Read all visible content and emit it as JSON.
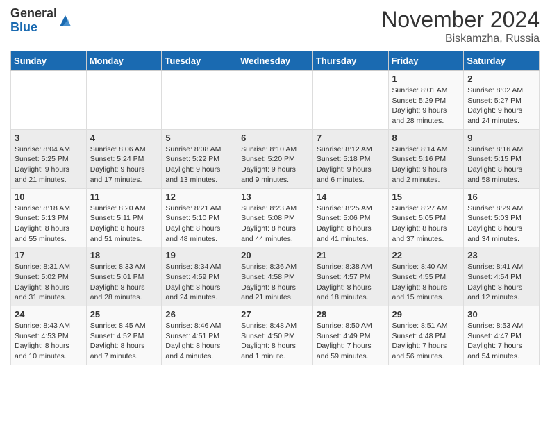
{
  "header": {
    "logo_general": "General",
    "logo_blue": "Blue",
    "month_title": "November 2024",
    "location": "Biskamzha, Russia"
  },
  "days_of_week": [
    "Sunday",
    "Monday",
    "Tuesday",
    "Wednesday",
    "Thursday",
    "Friday",
    "Saturday"
  ],
  "weeks": [
    [
      {
        "day": "",
        "info": ""
      },
      {
        "day": "",
        "info": ""
      },
      {
        "day": "",
        "info": ""
      },
      {
        "day": "",
        "info": ""
      },
      {
        "day": "",
        "info": ""
      },
      {
        "day": "1",
        "info": "Sunrise: 8:01 AM\nSunset: 5:29 PM\nDaylight: 9 hours and 28 minutes."
      },
      {
        "day": "2",
        "info": "Sunrise: 8:02 AM\nSunset: 5:27 PM\nDaylight: 9 hours and 24 minutes."
      }
    ],
    [
      {
        "day": "3",
        "info": "Sunrise: 8:04 AM\nSunset: 5:25 PM\nDaylight: 9 hours and 21 minutes."
      },
      {
        "day": "4",
        "info": "Sunrise: 8:06 AM\nSunset: 5:24 PM\nDaylight: 9 hours and 17 minutes."
      },
      {
        "day": "5",
        "info": "Sunrise: 8:08 AM\nSunset: 5:22 PM\nDaylight: 9 hours and 13 minutes."
      },
      {
        "day": "6",
        "info": "Sunrise: 8:10 AM\nSunset: 5:20 PM\nDaylight: 9 hours and 9 minutes."
      },
      {
        "day": "7",
        "info": "Sunrise: 8:12 AM\nSunset: 5:18 PM\nDaylight: 9 hours and 6 minutes."
      },
      {
        "day": "8",
        "info": "Sunrise: 8:14 AM\nSunset: 5:16 PM\nDaylight: 9 hours and 2 minutes."
      },
      {
        "day": "9",
        "info": "Sunrise: 8:16 AM\nSunset: 5:15 PM\nDaylight: 8 hours and 58 minutes."
      }
    ],
    [
      {
        "day": "10",
        "info": "Sunrise: 8:18 AM\nSunset: 5:13 PM\nDaylight: 8 hours and 55 minutes."
      },
      {
        "day": "11",
        "info": "Sunrise: 8:20 AM\nSunset: 5:11 PM\nDaylight: 8 hours and 51 minutes."
      },
      {
        "day": "12",
        "info": "Sunrise: 8:21 AM\nSunset: 5:10 PM\nDaylight: 8 hours and 48 minutes."
      },
      {
        "day": "13",
        "info": "Sunrise: 8:23 AM\nSunset: 5:08 PM\nDaylight: 8 hours and 44 minutes."
      },
      {
        "day": "14",
        "info": "Sunrise: 8:25 AM\nSunset: 5:06 PM\nDaylight: 8 hours and 41 minutes."
      },
      {
        "day": "15",
        "info": "Sunrise: 8:27 AM\nSunset: 5:05 PM\nDaylight: 8 hours and 37 minutes."
      },
      {
        "day": "16",
        "info": "Sunrise: 8:29 AM\nSunset: 5:03 PM\nDaylight: 8 hours and 34 minutes."
      }
    ],
    [
      {
        "day": "17",
        "info": "Sunrise: 8:31 AM\nSunset: 5:02 PM\nDaylight: 8 hours and 31 minutes."
      },
      {
        "day": "18",
        "info": "Sunrise: 8:33 AM\nSunset: 5:01 PM\nDaylight: 8 hours and 28 minutes."
      },
      {
        "day": "19",
        "info": "Sunrise: 8:34 AM\nSunset: 4:59 PM\nDaylight: 8 hours and 24 minutes."
      },
      {
        "day": "20",
        "info": "Sunrise: 8:36 AM\nSunset: 4:58 PM\nDaylight: 8 hours and 21 minutes."
      },
      {
        "day": "21",
        "info": "Sunrise: 8:38 AM\nSunset: 4:57 PM\nDaylight: 8 hours and 18 minutes."
      },
      {
        "day": "22",
        "info": "Sunrise: 8:40 AM\nSunset: 4:55 PM\nDaylight: 8 hours and 15 minutes."
      },
      {
        "day": "23",
        "info": "Sunrise: 8:41 AM\nSunset: 4:54 PM\nDaylight: 8 hours and 12 minutes."
      }
    ],
    [
      {
        "day": "24",
        "info": "Sunrise: 8:43 AM\nSunset: 4:53 PM\nDaylight: 8 hours and 10 minutes."
      },
      {
        "day": "25",
        "info": "Sunrise: 8:45 AM\nSunset: 4:52 PM\nDaylight: 8 hours and 7 minutes."
      },
      {
        "day": "26",
        "info": "Sunrise: 8:46 AM\nSunset: 4:51 PM\nDaylight: 8 hours and 4 minutes."
      },
      {
        "day": "27",
        "info": "Sunrise: 8:48 AM\nSunset: 4:50 PM\nDaylight: 8 hours and 1 minute."
      },
      {
        "day": "28",
        "info": "Sunrise: 8:50 AM\nSunset: 4:49 PM\nDaylight: 7 hours and 59 minutes."
      },
      {
        "day": "29",
        "info": "Sunrise: 8:51 AM\nSunset: 4:48 PM\nDaylight: 7 hours and 56 minutes."
      },
      {
        "day": "30",
        "info": "Sunrise: 8:53 AM\nSunset: 4:47 PM\nDaylight: 7 hours and 54 minutes."
      }
    ]
  ]
}
